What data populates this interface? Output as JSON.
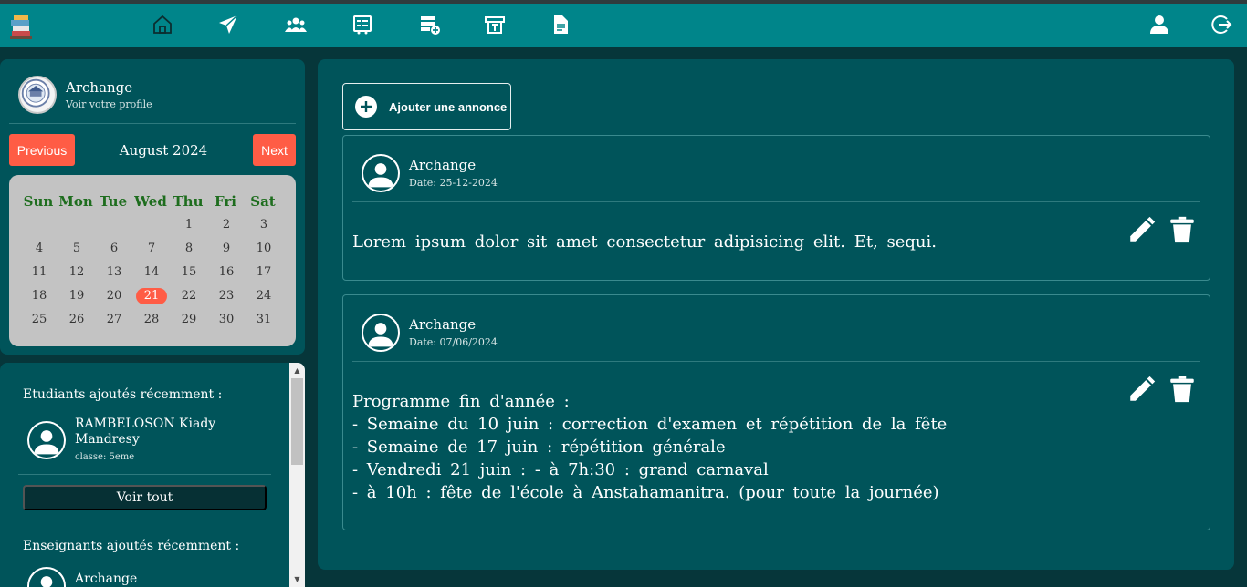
{
  "nav": {
    "logo": "books-logo",
    "items": [
      {
        "name": "home-icon"
      },
      {
        "name": "send-icon"
      },
      {
        "name": "users-icon"
      },
      {
        "name": "list-icon"
      },
      {
        "name": "list-add-icon"
      },
      {
        "name": "board-icon"
      },
      {
        "name": "document-icon"
      }
    ],
    "right": [
      {
        "name": "user-icon"
      },
      {
        "name": "logout-icon"
      }
    ]
  },
  "profile": {
    "name": "Archange",
    "subtitle": "Voir votre profile"
  },
  "calendar": {
    "prev_label": "Previous",
    "next_label": "Next",
    "month_label": "August 2024",
    "weekdays": [
      "Sun",
      "Mon",
      "Tue",
      "Wed",
      "Thu",
      "Fri",
      "Sat"
    ],
    "first_weekday_index": 4,
    "days_in_month": 31,
    "today": 21
  },
  "recent": {
    "students_title": "Etudiants ajoutés récemment :",
    "student": {
      "name": "RAMBELOSON Kiady Mandresy",
      "class": "classe: 5eme"
    },
    "see_all_label": "Voir tout",
    "teachers_title": "Enseignants ajoutés récemment :",
    "teacher": {
      "name": "Archange"
    }
  },
  "main": {
    "add_label": "Ajouter une annonce",
    "posts": [
      {
        "author": "Archange",
        "date": "Date: 25-12-2024",
        "body": "Lorem ipsum dolor sit amet consectetur adipisicing elit. Et, sequi."
      },
      {
        "author": "Archange",
        "date": "Date: 07/06/2024",
        "body": "Programme fin d'année :\n- Semaine du 10 juin : correction d'examen et répétition de la fête\n- Semaine de 17 juin : répétition générale\n- Vendredi 21 juin : - à 7h:30 : grand carnaval\n- à 10h : fête de l'école à Anstahamanitra. (pour toute la journée)"
      }
    ]
  },
  "colors": {
    "topbar": "#00858a",
    "panel": "#00545a",
    "background": "#06363a",
    "accent_red": "#ff5c45",
    "calendar_bg": "#c3c3c3",
    "weekday_green": "#1e6d1e"
  }
}
